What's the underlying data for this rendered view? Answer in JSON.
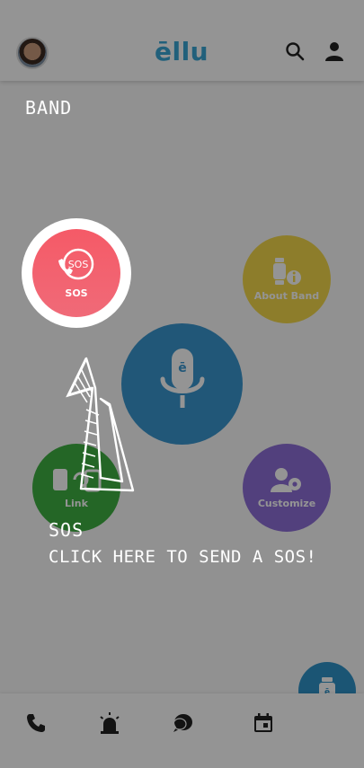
{
  "header": {
    "logo_text": "ēllu",
    "avatar_icon": "user-avatar-photo",
    "search_icon": "search-icon",
    "profile_icon": "person-icon"
  },
  "section": {
    "label": "BAND"
  },
  "tiles": {
    "sos": {
      "label": "SOS",
      "icon_text": "SOS",
      "color": "#f0616e"
    },
    "about_band": {
      "label": "About Band",
      "color": "#f3d84a"
    },
    "mic": {
      "icon_text": "ē",
      "color": "#3a96cf"
    },
    "link": {
      "label": "Link",
      "color": "#3fb043"
    },
    "customize": {
      "label": "Customize",
      "color": "#8e6fd7"
    }
  },
  "tooltip": {
    "title": "SOS",
    "body": "CLICK HERE TO SEND A SOS!"
  },
  "bottom_nav": [
    "phone-icon",
    "alarm-siren-icon",
    "chat-icon",
    "calendar-icon"
  ],
  "fab": {
    "icon": "band-watch-icon"
  }
}
